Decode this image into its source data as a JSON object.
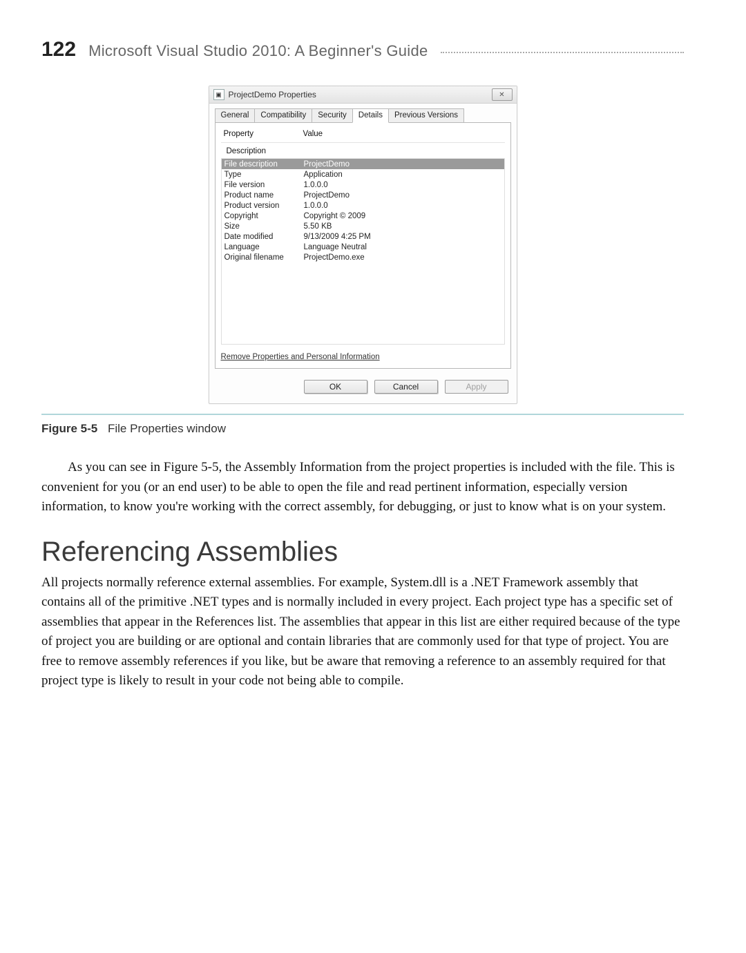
{
  "page": {
    "number": "122",
    "running_title": "Microsoft Visual Studio 2010: A Beginner's Guide"
  },
  "dialog": {
    "title": "ProjectDemo Properties",
    "close_glyph": "✕",
    "tabs": [
      "General",
      "Compatibility",
      "Security",
      "Details",
      "Previous Versions"
    ],
    "active_tab_index": 3,
    "header_property": "Property",
    "header_value": "Value",
    "group_label": "Description",
    "rows": [
      {
        "p": "File description",
        "v": "ProjectDemo",
        "selected": true
      },
      {
        "p": "Type",
        "v": "Application"
      },
      {
        "p": "File version",
        "v": "1.0.0.0"
      },
      {
        "p": "Product name",
        "v": "ProjectDemo"
      },
      {
        "p": "Product version",
        "v": "1.0.0.0"
      },
      {
        "p": "Copyright",
        "v": "Copyright © 2009"
      },
      {
        "p": "Size",
        "v": "5.50 KB"
      },
      {
        "p": "Date modified",
        "v": "9/13/2009 4:25 PM"
      },
      {
        "p": "Language",
        "v": "Language Neutral"
      },
      {
        "p": "Original filename",
        "v": "ProjectDemo.exe"
      }
    ],
    "remove_link": "Remove Properties and Personal Information",
    "buttons": {
      "ok": "OK",
      "cancel": "Cancel",
      "apply": "Apply"
    }
  },
  "figure": {
    "label": "Figure 5-5",
    "caption": "File Properties window"
  },
  "para1": "As you can see in Figure 5-5, the Assembly Information from the project properties is included with the file. This is convenient for you (or an end user) to be able to open the file and read pertinent information, especially version information, to know you're working with the correct assembly, for debugging, or just to know what is on your system.",
  "heading": "Referencing Assemblies",
  "para2": "All projects normally reference external assemblies. For example, System.dll is a .NET Framework assembly that contains all of the primitive .NET types and is normally included in every project. Each project type has a specific set of assemblies that appear in the References list. The assemblies that appear in this list are either required because of the type of project you are building or are optional and contain libraries that are commonly used for that type of project. You are free to remove assembly references if you like, but be aware that removing a reference to an assembly required for that project type is likely to result in your code not being able to compile."
}
